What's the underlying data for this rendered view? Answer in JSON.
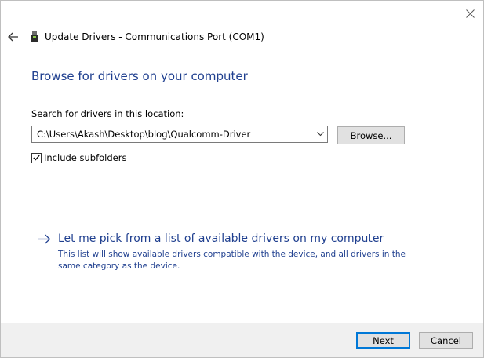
{
  "window": {
    "title": "Update Drivers - Communications Port (COM1)"
  },
  "icons": {
    "close": "close-icon",
    "back": "back-arrow-icon",
    "device": "device-icon",
    "dropdown": "chevron-down-icon",
    "link_arrow": "arrow-right-icon"
  },
  "main": {
    "heading": "Browse for drivers on your computer",
    "search_label": "Search for drivers in this location:",
    "path_value": "C:\\Users\\Akash\\Desktop\\blog\\Qualcomm-Driver",
    "browse_label": "Browse...",
    "include_subfolders": {
      "label": "Include subfolders",
      "checked": true
    },
    "pick_link": {
      "label": "Let me pick from a list of available drivers on my computer",
      "description": "This list will show available drivers compatible with the device, and all drivers in the same category as the device."
    }
  },
  "footer": {
    "next_label": "Next",
    "cancel_label": "Cancel"
  },
  "colors": {
    "link_blue": "#1f3f8f",
    "footer_bg": "#f0f0f0",
    "button_bg": "#e1e1e1",
    "focus_border": "#0078d7"
  }
}
